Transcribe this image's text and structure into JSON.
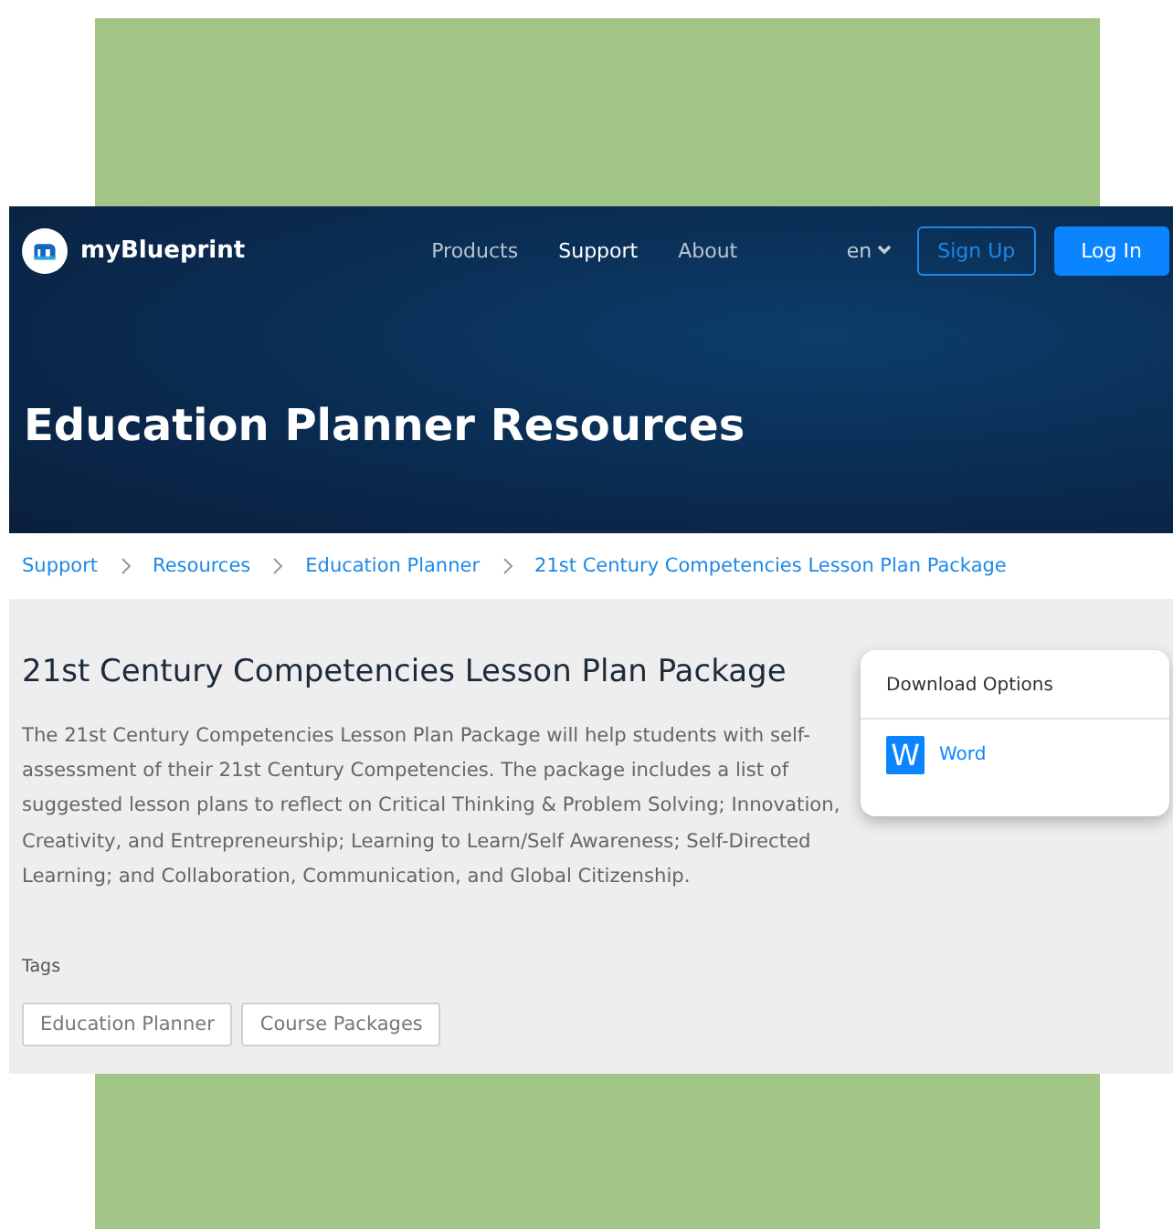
{
  "header": {
    "brand": "myBlueprint",
    "nav": [
      {
        "label": "Products",
        "selected": false
      },
      {
        "label": "Support",
        "selected": true
      },
      {
        "label": "About",
        "selected": false
      }
    ],
    "language": "en",
    "sign_up": "Sign Up",
    "log_in": "Log In",
    "hero_title": "Education Planner Resources"
  },
  "breadcrumb": [
    "Support",
    "Resources",
    "Education Planner",
    "21st Century Competencies Lesson Plan Package"
  ],
  "resource": {
    "title": "21st Century Competencies Lesson Plan Package",
    "description": "The 21st Century Competencies Lesson Plan Package will help students with self-assessment of their 21st Century Competencies. The package includes a list of suggested lesson plans to reflect on Critical Thinking & Problem Solving; Innovation, Creativity, and Entrepreneurship; Learning to Learn/Self Awareness; Self-Directed Learning; and Collaboration, Communication, and Global Citizenship.",
    "tags_label": "Tags",
    "tags": [
      "Education Planner",
      "Course Packages"
    ]
  },
  "download": {
    "title": "Download Options",
    "options": [
      {
        "icon_letter": "W",
        "label": "Word"
      }
    ]
  }
}
